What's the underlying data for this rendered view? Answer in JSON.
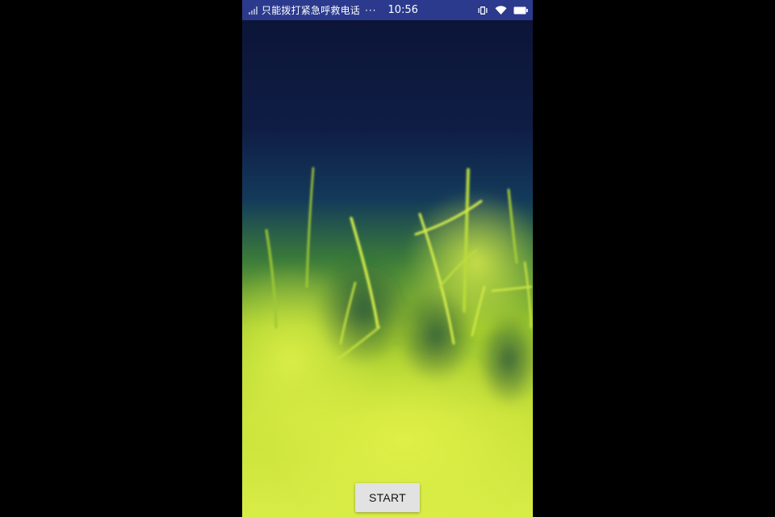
{
  "status_bar": {
    "carrier_text": "只能拨打紧急呼救电话",
    "overflow_indicator": "···",
    "time": "10:56",
    "icons": [
      "signal-icon",
      "vibrate-icon",
      "wifi-icon",
      "battery-icon"
    ],
    "background_color": "#2b3a8c"
  },
  "wallpaper": {
    "description_icon": "grass-wallpaper",
    "colors": {
      "sky_top": "#0c1538",
      "sky_mid": "#10305a",
      "grass_light": "#d6ec3c",
      "grass_mid": "#a6d02e",
      "grass_dark": "#2f6a2a"
    }
  },
  "main": {
    "start_button_label": "START"
  }
}
